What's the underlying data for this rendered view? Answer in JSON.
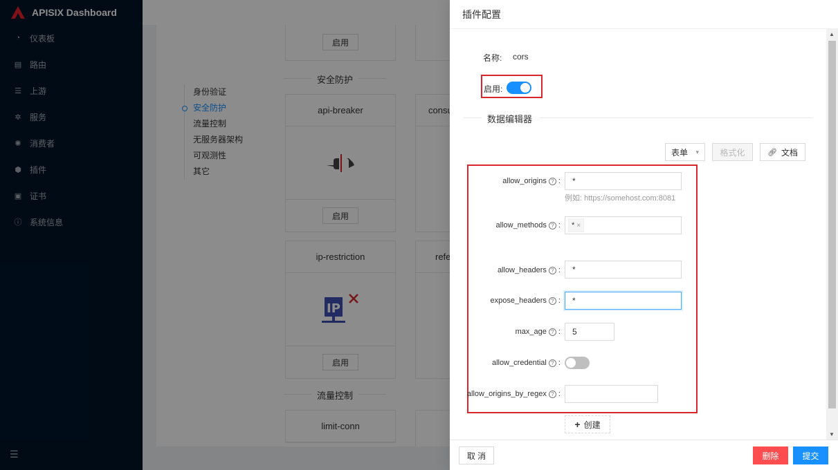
{
  "app": {
    "title": "APISIX Dashboard"
  },
  "sidebar": {
    "items": [
      {
        "label": "仪表板",
        "icon": "dashboard-icon"
      },
      {
        "label": "路由",
        "icon": "route-icon"
      },
      {
        "label": "上游",
        "icon": "upstream-icon"
      },
      {
        "label": "服务",
        "icon": "service-icon"
      },
      {
        "label": "消费者",
        "icon": "consumer-icon"
      },
      {
        "label": "插件",
        "icon": "plugin-icon"
      },
      {
        "label": "证书",
        "icon": "certificate-icon"
      },
      {
        "label": "系统信息",
        "icon": "info-icon"
      }
    ]
  },
  "plugins_page": {
    "anchors": [
      "身份验证",
      "安全防护",
      "流量控制",
      "无服务器架构",
      "可观测性",
      "其它"
    ],
    "active_anchor": "安全防护",
    "section_security": "安全防护",
    "section_traffic": "流量控制",
    "enable_label": "启用",
    "cards": [
      {
        "name": "api-breaker"
      },
      {
        "name": "ip-restriction"
      },
      {
        "name": "limit-conn"
      }
    ],
    "partial_cards": [
      "consu",
      "refe"
    ]
  },
  "drawer": {
    "title": "插件配置",
    "name_label": "名称:",
    "name_value": "cors",
    "enable_label": "启用:",
    "enabled": true,
    "editor_title": "数据编辑器",
    "mode_select": "表单",
    "format_button": "格式化",
    "docs_button": "文档",
    "fields": [
      {
        "label": "allow_origins",
        "value": "*",
        "hint": "例如: https://somehost.com:8081"
      },
      {
        "label": "allow_methods",
        "tags": [
          "*"
        ]
      },
      {
        "label": "allow_headers",
        "value": "*"
      },
      {
        "label": "expose_headers",
        "value": "*"
      },
      {
        "label": "max_age",
        "value": "5"
      },
      {
        "label": "allow_credential",
        "switch": false
      },
      {
        "label": "allow_origins_by_regex",
        "value": ""
      }
    ],
    "create_button": "创建",
    "cancel_button": "取 消",
    "delete_button": "删除",
    "submit_button": "提交"
  }
}
